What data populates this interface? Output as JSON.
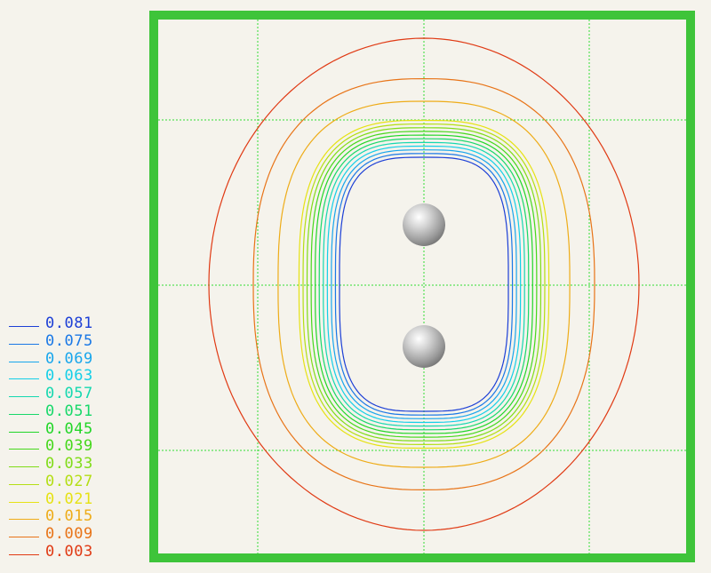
{
  "plot": {
    "frame_color": "#3ec43a",
    "grid_color": "#33dd33",
    "background": "#f5f3ec",
    "markers": [
      {
        "name": "upper-sphere",
        "shape": "sphere",
        "color": "#c8c8c8"
      },
      {
        "name": "lower-sphere",
        "shape": "sphere",
        "color": "#c8c8c8"
      }
    ]
  },
  "legend": {
    "items": [
      {
        "label": "0.081",
        "color": "#1c3fd6"
      },
      {
        "label": "0.075",
        "color": "#1a78e6"
      },
      {
        "label": "0.069",
        "color": "#18a6ec"
      },
      {
        "label": "0.063",
        "color": "#14cfe8"
      },
      {
        "label": "0.057",
        "color": "#16d8b0"
      },
      {
        "label": "0.051",
        "color": "#18d86a"
      },
      {
        "label": "0.045",
        "color": "#22d628"
      },
      {
        "label": "0.039",
        "color": "#46d81c"
      },
      {
        "label": "0.033",
        "color": "#80dc18"
      },
      {
        "label": "0.027",
        "color": "#b4de14"
      },
      {
        "label": "0.021",
        "color": "#e6e214"
      },
      {
        "label": "0.015",
        "color": "#eeac18"
      },
      {
        "label": "0.009",
        "color": "#e87418"
      },
      {
        "label": "0.003",
        "color": "#e03a14"
      }
    ]
  }
}
